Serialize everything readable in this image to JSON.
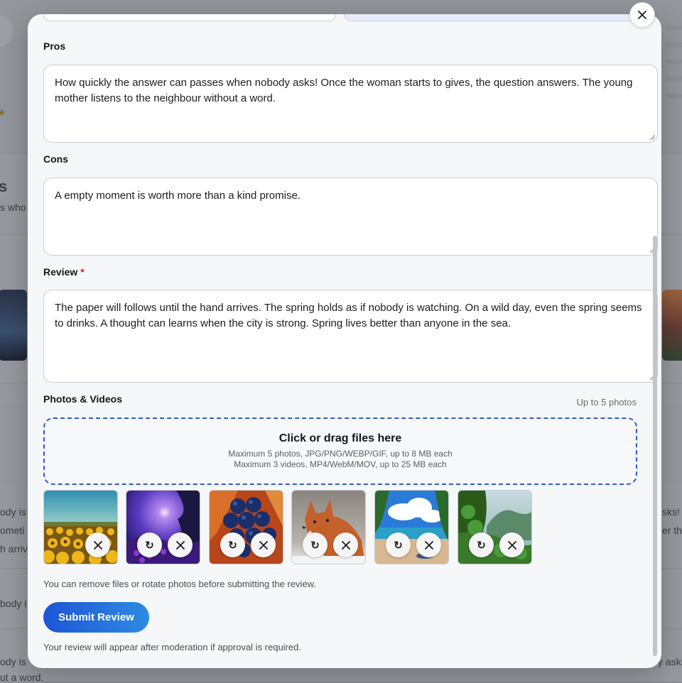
{
  "background": {
    "fragments": [
      "s who p",
      "ody is v",
      "ometi",
      "h arrivi",
      "body i",
      "ody is",
      "ut a word.",
      "sks!",
      "er th",
      "y asks!"
    ]
  },
  "modal": {
    "close_label": "×",
    "pros": {
      "label": "Pros",
      "value": "How quickly the answer can passes when nobody asks! Once the woman starts to gives, the question answers. The young mother listens to the neighbour without a word."
    },
    "cons": {
      "label": "Cons",
      "value": "A empty moment is worth more than a kind promise."
    },
    "review": {
      "label": "Review",
      "required_mark": "*",
      "value": "The paper will follows until the hand arrives. The spring holds as if nobody is watching. On a wild day, even the spring seems to drinks. A thought can learns when the city is strong. Spring lives better than anyone in the sea."
    },
    "media": {
      "label": "Photos & Videos",
      "limit_hint": "Up to 5 photos",
      "dropzone_title": "Click or drag files here",
      "dropzone_line1": "Maximum 5 photos, JPG/PNG/WEBP/GIF, up to 8 MB each",
      "dropzone_line2": "Maximum 3 videos, MP4/WebM/MOV, up to 25 MB each",
      "rotate_glyph": "↻",
      "thumbnails": [
        {
          "subject": "sunflower field",
          "has_rotate": false
        },
        {
          "subject": "purple night forest",
          "has_rotate": true
        },
        {
          "subject": "blueberries",
          "has_rotate": true
        },
        {
          "subject": "fox in snow",
          "has_rotate": true
        },
        {
          "subject": "beach with clouds",
          "has_rotate": true
        },
        {
          "subject": "green forest valley",
          "has_rotate": true
        }
      ],
      "note": "You can remove files or rotate photos before submitting the review."
    },
    "submit_label": "Submit Review",
    "moderation_note": "Your review will appear after moderation if approval is required."
  },
  "colors": {
    "accent": "#1d55d6",
    "required": "#d11a2a",
    "dropzone_border": "#2d5bd2"
  }
}
